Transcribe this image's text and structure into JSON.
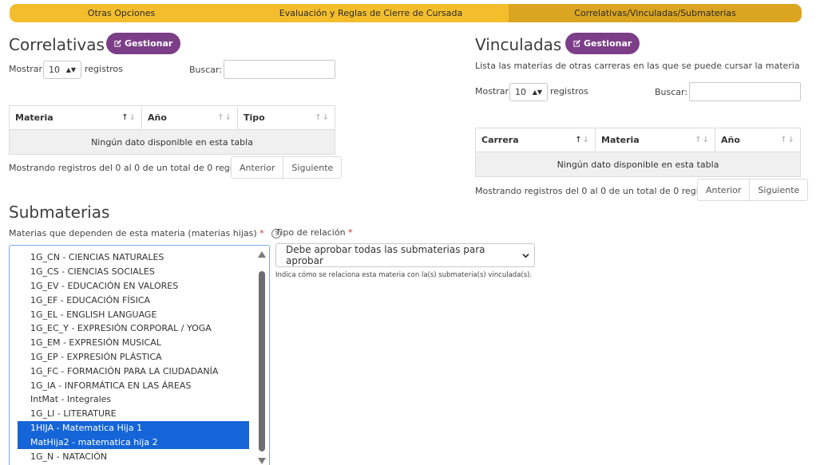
{
  "tabs": [
    {
      "label": "Otras Opciones"
    },
    {
      "label": "Evaluación y Reglas de Cierre de Cursada"
    },
    {
      "label": "Correlativas/Vinculadas/Submaterias"
    }
  ],
  "correlativas": {
    "title": "Correlativas",
    "manage_label": "Gestionar",
    "show_label": "Mostrar",
    "page_size": "10",
    "records_label": "registros",
    "search_label": "Buscar:",
    "columns": [
      "Materia",
      "Año",
      "Tipo"
    ],
    "empty_text": "Ningún dato disponible en esta tabla",
    "info_text": "Mostrando registros del 0 al 0 de un total de 0 registros",
    "prev_label": "Anterior",
    "next_label": "Siguiente"
  },
  "vinculadas": {
    "title": "Vinculadas",
    "manage_label": "Gestionar",
    "description": "Lista las materias de otras carreras en las que se puede cursar la materia",
    "show_label": "Mostrar",
    "page_size": "10",
    "records_label": "registros",
    "search_label": "Buscar:",
    "columns": [
      "Carrera",
      "Materia",
      "Año"
    ],
    "empty_text": "Ningún dato disponible en esta tabla",
    "info_text": "Mostrando registros del 0 al 0 de un total de 0 registros",
    "prev_label": "Anterior",
    "next_label": "Siguiente"
  },
  "submaterias": {
    "title": "Submaterias",
    "list_label": "Materias que dependen de esta materia (materias hijas)",
    "required_mark": "*",
    "help_glyph": "?",
    "relation_label": "Tipo de relación",
    "relation_value": "Debe aprobar todas las submaterias para aprobar",
    "relation_help": "Indica cómo se relaciona esta materia con la(s) submateria(s) vinculada(s).",
    "options": [
      {
        "label": "1G_CN - CIENCIAS NATURALES",
        "selected": false
      },
      {
        "label": "1G_CS - CIENCIAS SOCIALES",
        "selected": false
      },
      {
        "label": "1G_EV - EDUCACIÓN EN VALORES",
        "selected": false
      },
      {
        "label": "1G_EF - EDUCACIÓN FÍSICA",
        "selected": false
      },
      {
        "label": "1G_EL - ENGLISH LANGUAGE",
        "selected": false
      },
      {
        "label": "1G_EC_Y - EXPRESIÓN CORPORAL / YOGA",
        "selected": false
      },
      {
        "label": "1G_EM - EXPRESIÓN MUSICAL",
        "selected": false
      },
      {
        "label": "1G_EP - EXPRESIÓN PLÁSTICA",
        "selected": false
      },
      {
        "label": "1G_FC - FORMACIÓN PARA LA CIUDADANÍA",
        "selected": false
      },
      {
        "label": "1G_IA - INFORMÁTICA EN LAS ÁREAS",
        "selected": false
      },
      {
        "label": "IntMat - Integrales",
        "selected": false
      },
      {
        "label": "1G_LI - LITERATURE",
        "selected": false
      },
      {
        "label": "1HIJA - Matematica Hija 1",
        "selected": true
      },
      {
        "label": "MatHija2 - matematica hija 2",
        "selected": true
      },
      {
        "label": "1G_N - NATACIÓN",
        "selected": false
      }
    ]
  },
  "colors": {
    "tab_bg": "#f3bd2c",
    "tab_active_bg": "#dba521",
    "manage_button": "#7b3e87",
    "selected_option": "#1565d8"
  }
}
